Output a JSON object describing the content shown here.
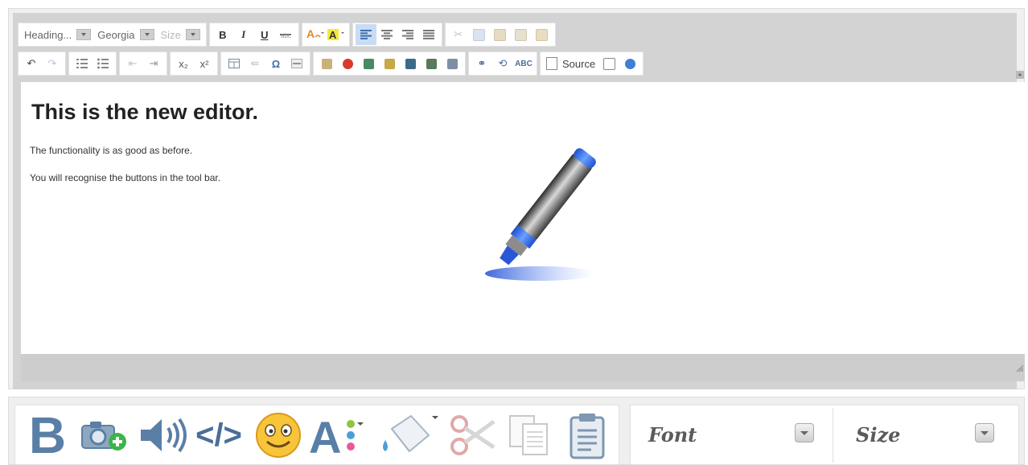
{
  "toolbar": {
    "format_dropdown": "Heading...",
    "font_dropdown": "Georgia",
    "size_dropdown": "Size",
    "bold_label": "B",
    "italic_label": "I",
    "underline_label": "U",
    "subscript_label": "x₂",
    "superscript_label": "x²",
    "source_label": "Source"
  },
  "editor": {
    "heading": "This is the new editor.",
    "paragraphs": [
      "The functionality is as good as before.",
      "You will recognise the buttons in the tool bar."
    ]
  },
  "bottom_toolbar": {
    "bold_label": "B",
    "code_label": "</>",
    "font_select": "Font",
    "size_select": "Size"
  },
  "colors": {
    "toolbar_bg": "#d3d3d3",
    "accent_blue": "#3f7fd8",
    "icon_blue": "#5a7fa6"
  }
}
